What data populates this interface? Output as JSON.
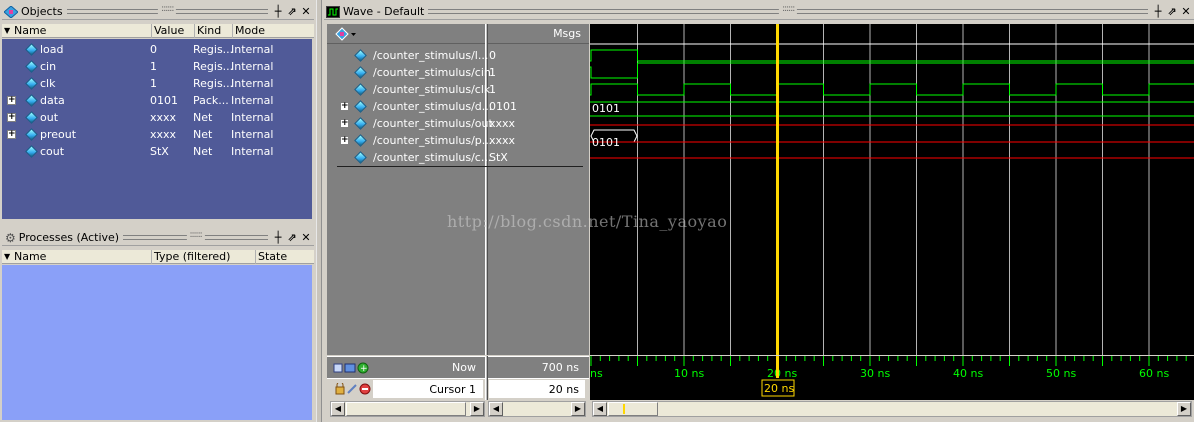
{
  "objects_panel": {
    "title": "Objects",
    "columns": [
      "Name",
      "Value",
      "Kind",
      "Mode"
    ],
    "rows": [
      {
        "name": "load",
        "value": "0",
        "kind": "Regis...",
        "mode": "Internal",
        "expandable": false
      },
      {
        "name": "cin",
        "value": "1",
        "kind": "Regis...",
        "mode": "Internal",
        "expandable": false
      },
      {
        "name": "clk",
        "value": "1",
        "kind": "Regis...",
        "mode": "Internal",
        "expandable": false
      },
      {
        "name": "data",
        "value": "0101",
        "kind": "Pack...",
        "mode": "Internal",
        "expandable": true
      },
      {
        "name": "out",
        "value": "xxxx",
        "kind": "Net",
        "mode": "Internal",
        "expandable": true
      },
      {
        "name": "preout",
        "value": "xxxx",
        "kind": "Net",
        "mode": "Internal",
        "expandable": true
      },
      {
        "name": "cout",
        "value": "StX",
        "kind": "Net",
        "mode": "Internal",
        "expandable": false
      }
    ]
  },
  "processes_panel": {
    "title": "Processes (Active)",
    "columns": [
      "Name",
      "Type (filtered)",
      "State"
    ]
  },
  "wave_window": {
    "title": "Wave - Default",
    "msgs_label": "Msgs",
    "signals": [
      {
        "name": "/counter_stimulus/l...",
        "value": "0",
        "expandable": false
      },
      {
        "name": "/counter_stimulus/cin",
        "value": "1",
        "expandable": false
      },
      {
        "name": "/counter_stimulus/clk",
        "value": "1",
        "expandable": false
      },
      {
        "name": "/counter_stimulus/d...",
        "value": "0101",
        "expandable": true
      },
      {
        "name": "/counter_stimulus/out",
        "value": "xxxx",
        "expandable": true
      },
      {
        "name": "/counter_stimulus/p...",
        "value": "xxxx",
        "expandable": true
      },
      {
        "name": "/counter_stimulus/c...",
        "value": "StX",
        "expandable": false
      }
    ],
    "bus_labels": {
      "data": "0101",
      "out": "0101"
    },
    "now_label": "Now",
    "now_value": "700 ns",
    "cursor_label": "Cursor 1",
    "cursor_value": "20 ns",
    "cursor_flag": "20 ns",
    "cursor_time_ns": 20,
    "timeline_ticks": [
      "ns",
      "10 ns",
      "20 ns",
      "30 ns",
      "40 ns",
      "50 ns",
      "60 ns"
    ],
    "colors": {
      "signal": "#00ff00",
      "unknown": "#ff0000",
      "cursor": "#ffd800",
      "grid": "#b4b4b4"
    }
  },
  "watermark": "http://blog.csdn.net/Tina_yaoyao"
}
